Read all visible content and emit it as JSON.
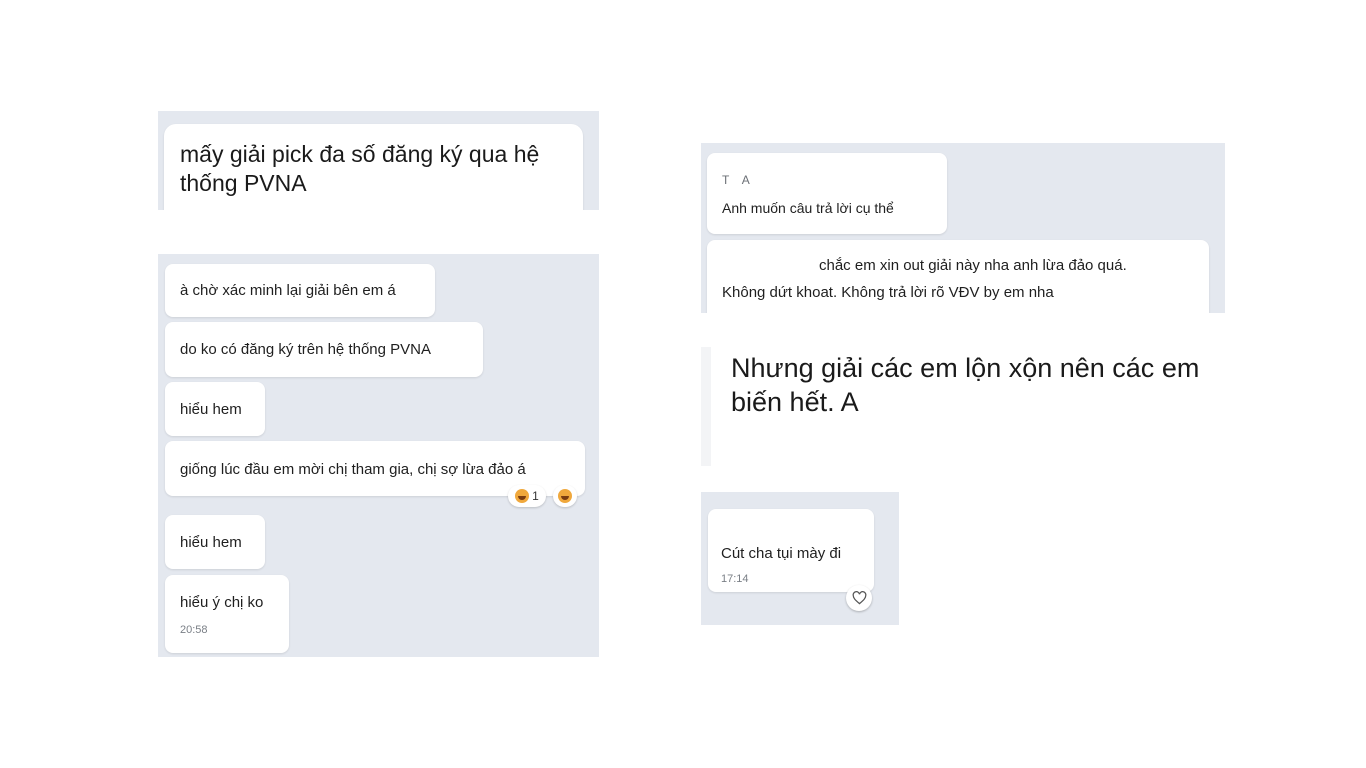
{
  "panel1": {
    "message": "mấy giải pick đa số đăng ký qua hệ thống PVNA",
    "line1": "mấy giải pick đa số đăng ký qua hệ",
    "line2": "thống PVNA"
  },
  "panel2": {
    "messages": [
      {
        "text": "à chờ xác minh lại giải bên em á"
      },
      {
        "text": "do ko có đăng ký trên hệ thống PVNA"
      },
      {
        "text": "hiểu hem"
      },
      {
        "text": "giống lúc đầu em mời chị tham gia, chị sợ lừa đảo á",
        "reaction_count": "1"
      },
      {
        "text": "hiểu hem"
      },
      {
        "text": "hiểu ý chị ko",
        "time": "20:58"
      }
    ]
  },
  "panel3": {
    "sender": "T    A",
    "reply_text": "Anh muốn câu trả lời cụ thể",
    "line1": "chắc em xin out giải này nha anh lừa đảo quá.",
    "line2": "Không dứt khoat. Không trả lời rõ VĐV by em nha"
  },
  "panel4": {
    "line1": "Nhưng giải các em lộn xộn nên các em",
    "line2": "biến hết. A"
  },
  "panel5": {
    "text": "Cút cha tụi mày đi",
    "time": "17:14"
  }
}
